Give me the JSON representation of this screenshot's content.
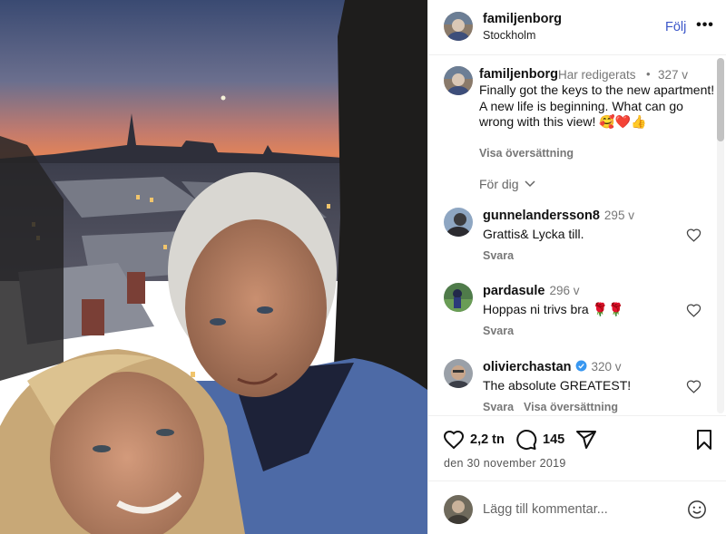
{
  "post": {
    "username": "familjenborg",
    "location": "Stockholm",
    "follow_label": "Följ",
    "more_label": "•••"
  },
  "caption": {
    "username": "familjenborg",
    "edited": "Har redigerats",
    "dot": "•",
    "time": "327 v",
    "text": "Finally got the keys to the new apartment! A new life is beginning. What can go wrong with this view! 🥰❤️👍",
    "see_translation": "Visa översättning"
  },
  "for_you_label": "För dig",
  "comments": [
    {
      "username": "gunnelandersson8",
      "time": "295 v",
      "text": "Grattis& Lycka till.",
      "reply": "Svara",
      "translation": "",
      "verified": false
    },
    {
      "username": "pardasule",
      "time": "296 v",
      "text": "Hoppas ni trivs bra 🌹🌹",
      "reply": "Svara",
      "translation": "",
      "verified": false
    },
    {
      "username": "olivierchastan",
      "time": "320 v",
      "text": "The absolute GREATEST!",
      "reply": "Svara",
      "translation": "Visa översättning",
      "verified": true
    }
  ],
  "actions": {
    "likes": "2,2 tn",
    "comments": "145",
    "date": "den 30 november 2019"
  },
  "add_comment": {
    "placeholder": "Lägg till kommentar..."
  },
  "icons": {
    "like": "heart-icon",
    "comment": "comment-bubble-icon",
    "share": "send-icon",
    "save": "bookmark-icon",
    "emoji": "smiley-icon",
    "verified": "verified-badge-icon",
    "for_you_caret": "chevron-down-icon"
  },
  "colors": {
    "follow": "#3b56c9",
    "verified": "#3897f0",
    "muted": "#777777"
  }
}
